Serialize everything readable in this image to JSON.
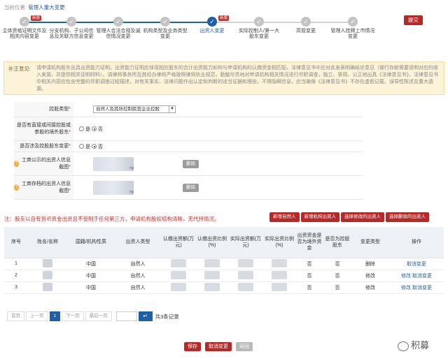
{
  "breadcrumb": {
    "prefix": "当前位置:",
    "current": "管理人重大变更"
  },
  "steps": [
    {
      "label": "主体资格证明文件及相关内容变更",
      "badge": "新版"
    },
    {
      "label": "分支机构、子公司信息及关联方信息变更",
      "badge": ""
    },
    {
      "label": "管理人合法合规及诚信情况变更",
      "badge": ""
    },
    {
      "label": "机构类型及业务类型变更",
      "badge": ""
    },
    {
      "label": "出资人变更",
      "badge": "新版"
    },
    {
      "label": "实际控制人/第一大股东变更",
      "badge": ""
    },
    {
      "label": "高管变更",
      "badge": ""
    },
    {
      "label": "管理人挂牌上市情况变更",
      "badge": ""
    }
  ],
  "submit_label": "提交",
  "notice": {
    "label": "补正意见:",
    "text": "请申请机构股东出具出资能力证明。出资能力证明应体现相应股东的合计出资能力如何与申请机构的认缴资金相匹配，法律意见书中应对此发表明确结论意见（银行存款需要说明对应的收入来源，并提供相关证明材料）。请律师事务所及其经办律师严格按照律师执业规范，勤勉尽责地对申请机构相关情况进行尽职调查，独立、客观、公正地出具《法律意见书》，法律意见书中相关内容应包含完整的尽职调查过程描述，对有关事实、法律问题作出认定和判断的适当证据和理由，不得隐瞒信息，应当确保《法律意见书》不存在虚假记载、误导性陈述及重大遗漏。"
  },
  "form": {
    "holding_type_label": "控股类型",
    "holding_type_value": "自然人及其所控制民营企业控股",
    "foreign_label": "是否有直接或间接控股或参股的境外股东",
    "foreign_yes": "是",
    "foreign_no": "否",
    "pledge_label": "是否涉及控股股东变更",
    "pledge_yes": "是",
    "pledge_no": "否",
    "shot1_label": "工商公示的出资人信息截图",
    "shot1_ext": "ng",
    "shot2_label": "工商存档的出资人信息截图",
    "shot2_ext": "ng",
    "delete_label": "删除"
  },
  "note": "注：股东以自有货币资金出资且不受制于任何第三方，申请机构股权结构清晰，无代持情况。",
  "actions": [
    "新增自然人",
    "新增机构出资人",
    "选择修改的出资人",
    "选择删除的出资人"
  ],
  "table": {
    "headers": [
      "序号",
      "姓名/名称",
      "国籍/机构性质",
      "出资人类型",
      "认缴出资额(万元)",
      "认缴出资比例(%)",
      "实际出资额(万元)",
      "实际出资比例(%)",
      "出资资金是否为境外资金",
      "是否为控股股东",
      "变更类型",
      "操作"
    ],
    "rows": [
      {
        "no": "1",
        "nation": "中国",
        "type": "自然人",
        "foreign": "否",
        "controller": "否",
        "change": "删除",
        "ops": [
          "取消变更"
        ]
      },
      {
        "no": "2",
        "nation": "中国",
        "type": "自然人",
        "foreign": "否",
        "controller": "否",
        "change": "修改",
        "ops": [
          "修改",
          "取消变更"
        ]
      },
      {
        "no": "3",
        "nation": "中国",
        "type": "自然人",
        "foreign": "否",
        "controller": "否",
        "change": "修改",
        "ops": [
          "修改",
          "取消变更"
        ]
      }
    ]
  },
  "pager": {
    "first": "首页",
    "prev": "上一页",
    "current": "1",
    "next": "下一页",
    "last": "最后一页",
    "total": "共3条记录"
  },
  "bottom": {
    "save": "保存",
    "cancel": "取消变更",
    "back": "返回"
  },
  "watermark": "积募",
  "colors": {
    "accent": "#1f5fa8",
    "danger": "#b52a27",
    "notice_bg": "#fdf3d8"
  }
}
